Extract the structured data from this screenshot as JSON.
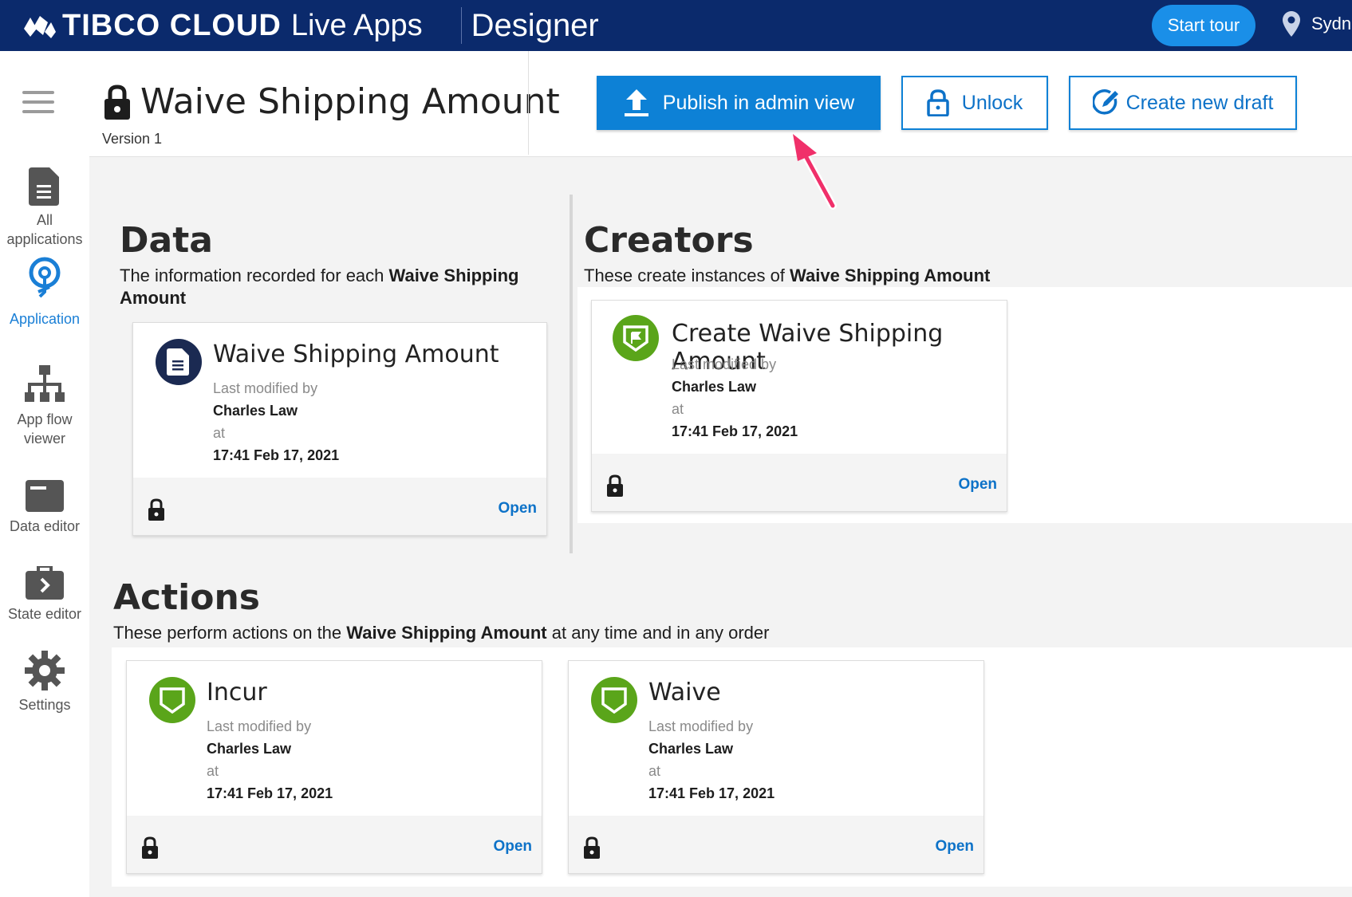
{
  "topbar": {
    "brand": "TIBCO CLOUD",
    "brand_sub": "Live Apps",
    "section": "Designer",
    "start_tour": "Start tour",
    "location": "Sydn"
  },
  "sidebar": {
    "items": [
      {
        "label": "All applications",
        "icon": "document-icon"
      },
      {
        "label": "Application",
        "icon": "lightbulb-icon",
        "active": true
      },
      {
        "label": "App flow viewer",
        "icon": "sitemap-icon"
      },
      {
        "label": "Data editor",
        "icon": "card-icon"
      },
      {
        "label": "State editor",
        "icon": "briefcase-icon"
      },
      {
        "label": "Settings",
        "icon": "gear-icon"
      }
    ]
  },
  "header": {
    "title": "Waive Shipping Amount",
    "version": "Version 1",
    "publish_label": "Publish in admin view",
    "unlock_label": "Unlock",
    "draft_label": "Create new draft"
  },
  "data_section": {
    "heading": "Data",
    "desc_prefix": "The information recorded for each ",
    "desc_bold": "Waive Shipping Amount",
    "card": {
      "title": "Waive Shipping Amount",
      "modified_label": "Last modified by",
      "modified_by": "Charles Law",
      "at_label": "at",
      "timestamp": "17:41 Feb 17, 2021",
      "open_label": "Open"
    }
  },
  "creators_section": {
    "heading": "Creators",
    "desc_prefix": "These create instances of ",
    "desc_bold": "Waive Shipping Amount",
    "card": {
      "title": "Create Waive Shipping Amount",
      "modified_label": "Last modified by",
      "modified_by": "Charles Law",
      "at_label": "at",
      "timestamp": "17:41 Feb 17, 2021",
      "open_label": "Open"
    }
  },
  "actions_section": {
    "heading": "Actions",
    "desc_prefix": "These perform actions on the ",
    "desc_bold": "Waive Shipping Amount",
    "desc_suffix": " at any time and in any order",
    "cards": [
      {
        "title": "Incur",
        "modified_label": "Last modified by",
        "modified_by": "Charles Law",
        "at_label": "at",
        "timestamp": "17:41 Feb 17, 2021",
        "open_label": "Open"
      },
      {
        "title": "Waive",
        "modified_label": "Last modified by",
        "modified_by": "Charles Law",
        "at_label": "at",
        "timestamp": "17:41 Feb 17, 2021",
        "open_label": "Open"
      }
    ]
  },
  "colors": {
    "topbar": "#0b2a6c",
    "primary": "#0d81d6",
    "creator_green": "#5aa51a",
    "data_navy": "#1b2a52",
    "arrow": "#f0306a"
  }
}
